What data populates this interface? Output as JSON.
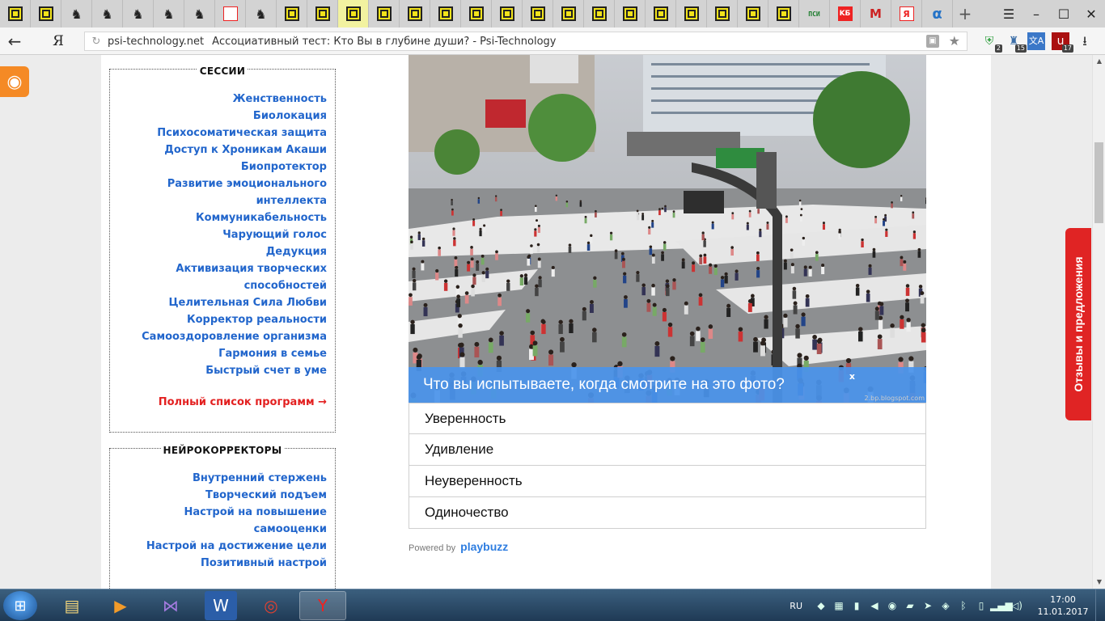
{
  "browser": {
    "tabs": [
      {
        "icon": "maze-icon"
      },
      {
        "icon": "maze-icon"
      },
      {
        "icon": "horse-icon"
      },
      {
        "icon": "horse-icon"
      },
      {
        "icon": "horse-icon"
      },
      {
        "icon": "horse-icon"
      },
      {
        "icon": "horse-icon"
      },
      {
        "icon": "yandex-icon"
      },
      {
        "icon": "horse-icon"
      },
      {
        "icon": "maze-icon"
      },
      {
        "icon": "maze-icon"
      },
      {
        "icon": "maze-icon",
        "active": true
      },
      {
        "icon": "maze-icon"
      },
      {
        "icon": "maze-icon"
      },
      {
        "icon": "maze-icon"
      },
      {
        "icon": "maze-icon"
      },
      {
        "icon": "maze-icon"
      },
      {
        "icon": "maze-icon"
      },
      {
        "icon": "maze-icon"
      },
      {
        "icon": "maze-icon"
      },
      {
        "icon": "maze-icon"
      },
      {
        "icon": "maze-icon"
      },
      {
        "icon": "maze-icon"
      },
      {
        "icon": "maze-icon"
      },
      {
        "icon": "maze-icon"
      },
      {
        "icon": "maze-icon"
      },
      {
        "icon": "psi-icon",
        "label": "ПСИ"
      },
      {
        "icon": "kb-icon",
        "label": "KБ"
      },
      {
        "icon": "mm-icon",
        "label": "M"
      },
      {
        "icon": "yandex-icon",
        "label": "Я"
      },
      {
        "icon": "alpha-icon",
        "label": "α"
      }
    ],
    "new_tab": "+",
    "yandex_logo": "Я",
    "url_domain": "psi-technology.net",
    "page_title": "Ассоциативный тест: Кто Вы в глубине души? - Psi-Technology",
    "extensions": [
      {
        "icon": "shield-icon",
        "badge": "2"
      },
      {
        "icon": "vk-icon",
        "badge": "15"
      },
      {
        "icon": "translate-icon",
        "badge": ""
      },
      {
        "icon": "ublock-icon",
        "badge": "17"
      }
    ]
  },
  "sidebar": {
    "sessions": {
      "title": "СЕССИИ",
      "items": [
        "Женственность",
        "Биолокация",
        "Психосоматическая защита",
        "Доступ к Хроникам Акаши",
        "Биопротектор",
        "Развитие эмоционального интеллекта",
        "Коммуникабельность",
        "Чарующий голос",
        "Дедукция",
        "Активизация творческих способностей",
        "Целительная Сила Любви",
        "Корректор реальности",
        "Самооздоровление организма",
        "Гармония в семье",
        "Быстрый счет в уме"
      ],
      "full_list": "Полный список программ →"
    },
    "correctors": {
      "title": "НЕЙРОКОРРЕКТОРЫ",
      "items": [
        "Внутренний стержень",
        "Творческий подъем",
        "Настрой на повышение самооценки",
        "Настрой на достижение цели",
        "Позитивный настрой"
      ]
    }
  },
  "quiz": {
    "question": "Что вы испытываете, когда смотрите на это фото?",
    "close": "x",
    "photo_credit": "2.bp.blogspot.com",
    "answers": [
      "Уверенность",
      "Удивление",
      "Неуверенность",
      "Одиночество"
    ],
    "powered_by": "Powered by",
    "brand": "playbuzz"
  },
  "feedback_tab": "Отзывы и предложения",
  "taskbar": {
    "apps": [
      {
        "icon": "explorer-icon"
      },
      {
        "icon": "media-player-icon"
      },
      {
        "icon": "visual-studio-icon"
      },
      {
        "icon": "word-icon"
      },
      {
        "icon": "chrome-icon"
      },
      {
        "icon": "yandex-browser-icon",
        "active": true
      }
    ],
    "lang": "RU",
    "time": "17:00",
    "date": "11.01.2017"
  },
  "colors": {
    "link": "#2266cc",
    "full_list": "#e32020",
    "question_bar": "#4a94ec",
    "feedback": "#e02424",
    "rss": "#f58a25"
  }
}
